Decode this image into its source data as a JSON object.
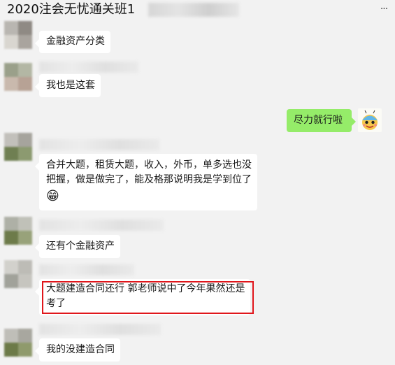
{
  "window": {
    "title": "2020注会无忧通关班1",
    "more_glyph": "···"
  },
  "messages": [
    {
      "side": "left",
      "text": "金融资产分类"
    },
    {
      "side": "left",
      "text": "我也是这套"
    },
    {
      "side": "right",
      "text": "尽力就行啦"
    },
    {
      "side": "left",
      "text_line1": "合并大题，租赁大题，收入，外币，单多选也没",
      "text_line2": "把握，做是做完了，能及格那说明我是学到位了",
      "emoji": "😁"
    },
    {
      "side": "left",
      "text": "还有个金融资产"
    },
    {
      "side": "left",
      "text_line1": "大题建造合同还行 郭老师说中了今年果然还是",
      "text_line2": "考了",
      "highlighted": true
    },
    {
      "side": "left",
      "text": "我的没建造合同"
    }
  ],
  "colors": {
    "background": "#f2f2f2",
    "bubble_left": "#ffffff",
    "bubble_right": "#95ec69",
    "highlight": "#e0161b"
  }
}
